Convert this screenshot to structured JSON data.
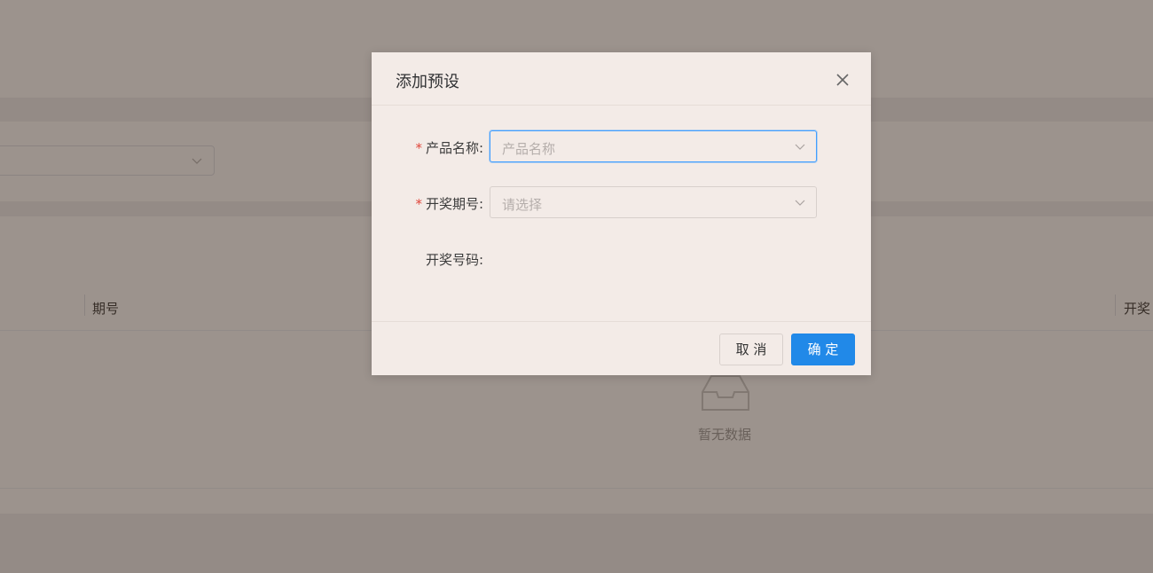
{
  "background": {
    "table": {
      "columns": [
        "期号",
        "开奖"
      ],
      "empty_text": "暂无数据"
    }
  },
  "dialog": {
    "title": "添加预设",
    "fields": [
      {
        "label": "产品名称:",
        "required": true,
        "placeholder": "产品名称",
        "focused": true
      },
      {
        "label": "开奖期号:",
        "required": true,
        "placeholder": "请选择"
      },
      {
        "label": "开奖号码:",
        "required": false
      }
    ],
    "buttons": {
      "cancel": "取 消",
      "confirm": "确 定"
    }
  },
  "colors": {
    "primary": "#2189e8",
    "required": "#e0453a",
    "dialog_bg": "#f3ebe7"
  }
}
